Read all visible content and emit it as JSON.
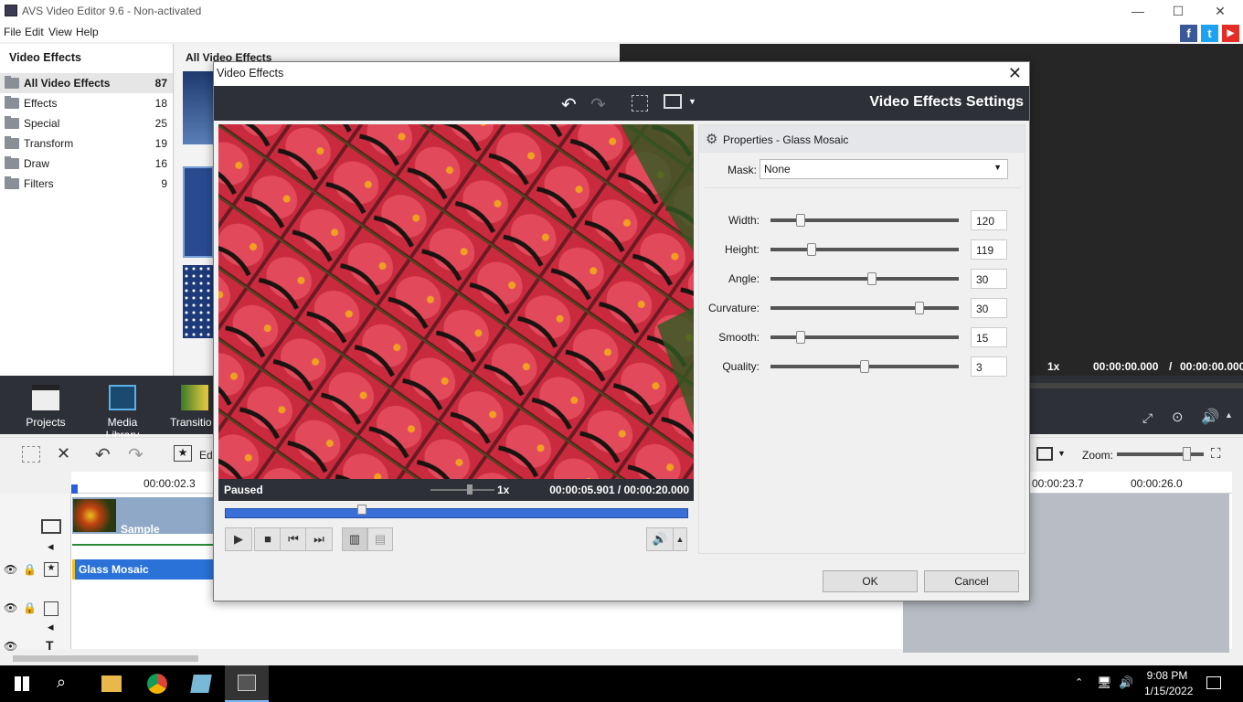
{
  "app": {
    "title": "AVS Video Editor 9.6 - Non-activated"
  },
  "window_controls": {
    "minimize": "—",
    "maximize": "☐",
    "close": "✕"
  },
  "menu": [
    "File",
    "Edit",
    "View",
    "Help"
  ],
  "social": {
    "facebook": "f",
    "twitter": "t",
    "youtube": "▶"
  },
  "left_panel": {
    "title": "Video Effects",
    "categories": [
      {
        "label": "All Video Effects",
        "count": "87"
      },
      {
        "label": "Effects",
        "count": "18"
      },
      {
        "label": "Special",
        "count": "25"
      },
      {
        "label": "Transform",
        "count": "19"
      },
      {
        "label": "Draw",
        "count": "16"
      },
      {
        "label": "Filters",
        "count": "9"
      }
    ]
  },
  "mid_panel": {
    "title": "All Video Effects"
  },
  "dock": {
    "projects": "Projects",
    "media_library": "Media Library",
    "transitions": "Transitio"
  },
  "player": {
    "speed": "1x",
    "time_current": "00:00:00.000",
    "time_sep": "/",
    "time_total": "00:00:00.000"
  },
  "timeline": {
    "edit_label": "Edi",
    "zoom_label": "Zoom:",
    "ruler": [
      "00:00:02.3",
      "00:00:23.7",
      "00:00:26.0"
    ],
    "clip_label": "Sample",
    "effect_label": "Glass Mosaic"
  },
  "dialog": {
    "title": "Video Effects",
    "close": "✕",
    "header_title": "Video Effects Settings",
    "preview": {
      "status": "Paused",
      "speed": "1x",
      "time_current": "00:00:05.901",
      "time_sep": "/",
      "time_total": "00:00:20.000",
      "seek_position": 0.295
    },
    "properties": {
      "title": "Properties - Glass Mosaic",
      "mask_label": "Mask:",
      "mask_value": "None",
      "params": [
        {
          "label": "Width:",
          "value": "120",
          "slider": 0.16
        },
        {
          "label": "Height:",
          "value": "119",
          "slider": 0.22
        },
        {
          "label": "Angle:",
          "value": "30",
          "slider": 0.54
        },
        {
          "label": "Curvature:",
          "value": "30",
          "slider": 0.79
        },
        {
          "label": "Smooth:",
          "value": "15",
          "slider": 0.16
        },
        {
          "label": "Quality:",
          "value": "3",
          "slider": 0.5
        }
      ]
    },
    "ok_label": "OK",
    "cancel_label": "Cancel"
  },
  "taskbar": {
    "time": "9:08 PM",
    "date": "1/15/2022"
  }
}
